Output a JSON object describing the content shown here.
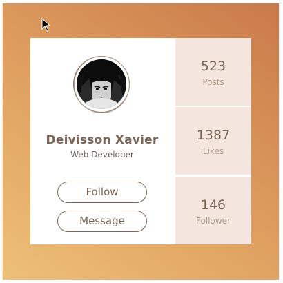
{
  "profile": {
    "name": "Deivisson Xavier",
    "role": "Web Developer",
    "avatar_icon": "avatar-image"
  },
  "actions": {
    "follow_label": "Follow",
    "message_label": "Message"
  },
  "stats": [
    {
      "value": "523",
      "label": "Posts"
    },
    {
      "value": "1387",
      "label": "Likes"
    },
    {
      "value": "146",
      "label": "Follower"
    }
  ],
  "colors": {
    "accent": "#7a6556",
    "stat_bg": "#f4e6de",
    "bg_gradient_start": "#c97a4a",
    "bg_gradient_end": "#eec078"
  }
}
